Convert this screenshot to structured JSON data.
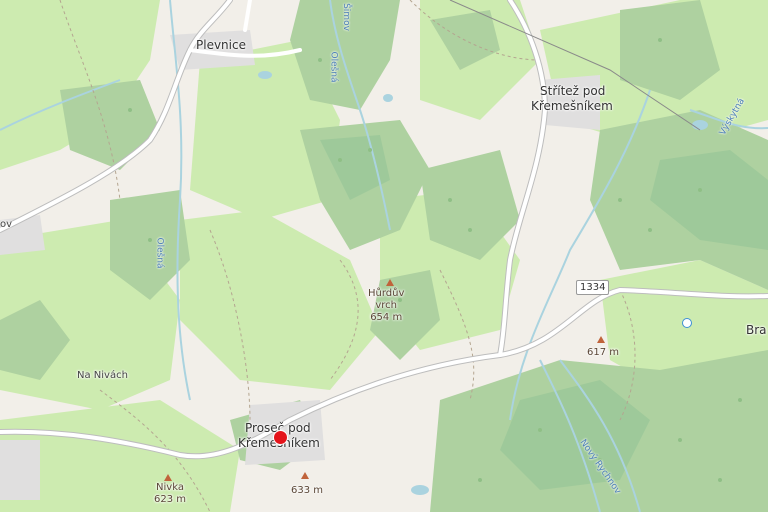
{
  "map": {
    "places": {
      "plevnice": "Plevnice",
      "strite_line1": "Střítež pod",
      "strite_line2": "Křemešníkem",
      "prosec_line1": "Proseč pod",
      "prosec_line2": "Křemešníkem",
      "na_nivach": "Na Nivách",
      "left_cut": "ov",
      "right_cut": "Bra"
    },
    "peaks": {
      "hurduv_name1": "Hůrdův",
      "hurduv_name2": "vrch",
      "hurduv_ele": "654 m",
      "nivka_name": "Nivka",
      "nivka_ele": "623 m",
      "p617": "617 m",
      "p633": "633 m"
    },
    "streams": {
      "olesna_top": "Olešná",
      "olesna_left": "Olešná",
      "simov": "Šimov",
      "vyskytna": "Výskytná",
      "novy_rychnov": "Nový Rychnov"
    },
    "road_ref": "1334",
    "colors": {
      "background": "#f2efe9",
      "meadow": "#cdebb0",
      "forest": "#aed1a0",
      "forest_dark": "#9ec99a",
      "road": "#ffffff",
      "water": "#aad3df",
      "marker": "#e4141b"
    },
    "marker_icon": "location-pin"
  }
}
